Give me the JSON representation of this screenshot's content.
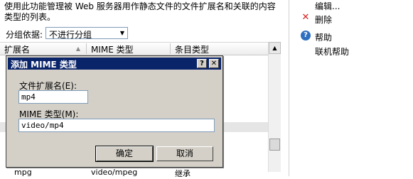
{
  "main": {
    "description": "使用此功能管理被 Web 服务器用作静态文件的文件扩展名和关联的内容\n类型的列表。",
    "group_label": "分组依据:",
    "group_value": "不进行分组",
    "columns": [
      "扩展名",
      "MIME 类型",
      "条目类型"
    ],
    "last_row": [
      "mpg",
      "video/mpeg",
      "继承"
    ]
  },
  "actions": {
    "edit": "编辑...",
    "delete": "删除",
    "help": "帮助",
    "online_help": "联机帮助"
  },
  "dialog": {
    "title": "添加 MIME 类型",
    "help_btn": "?",
    "close_btn": "✕",
    "ext_label": "文件扩展名(E):",
    "ext_value": "mp4",
    "mime_label": "MIME 类型(M):",
    "mime_value": "video/mp4",
    "ok": "确定",
    "cancel": "取消"
  },
  "icons": {
    "delete": "red-x-icon",
    "help": "help-circle-icon"
  },
  "colors": {
    "titlebar": "#0a246a",
    "delete_icon": "#d42020",
    "help_icon": "#2f6fbf"
  }
}
